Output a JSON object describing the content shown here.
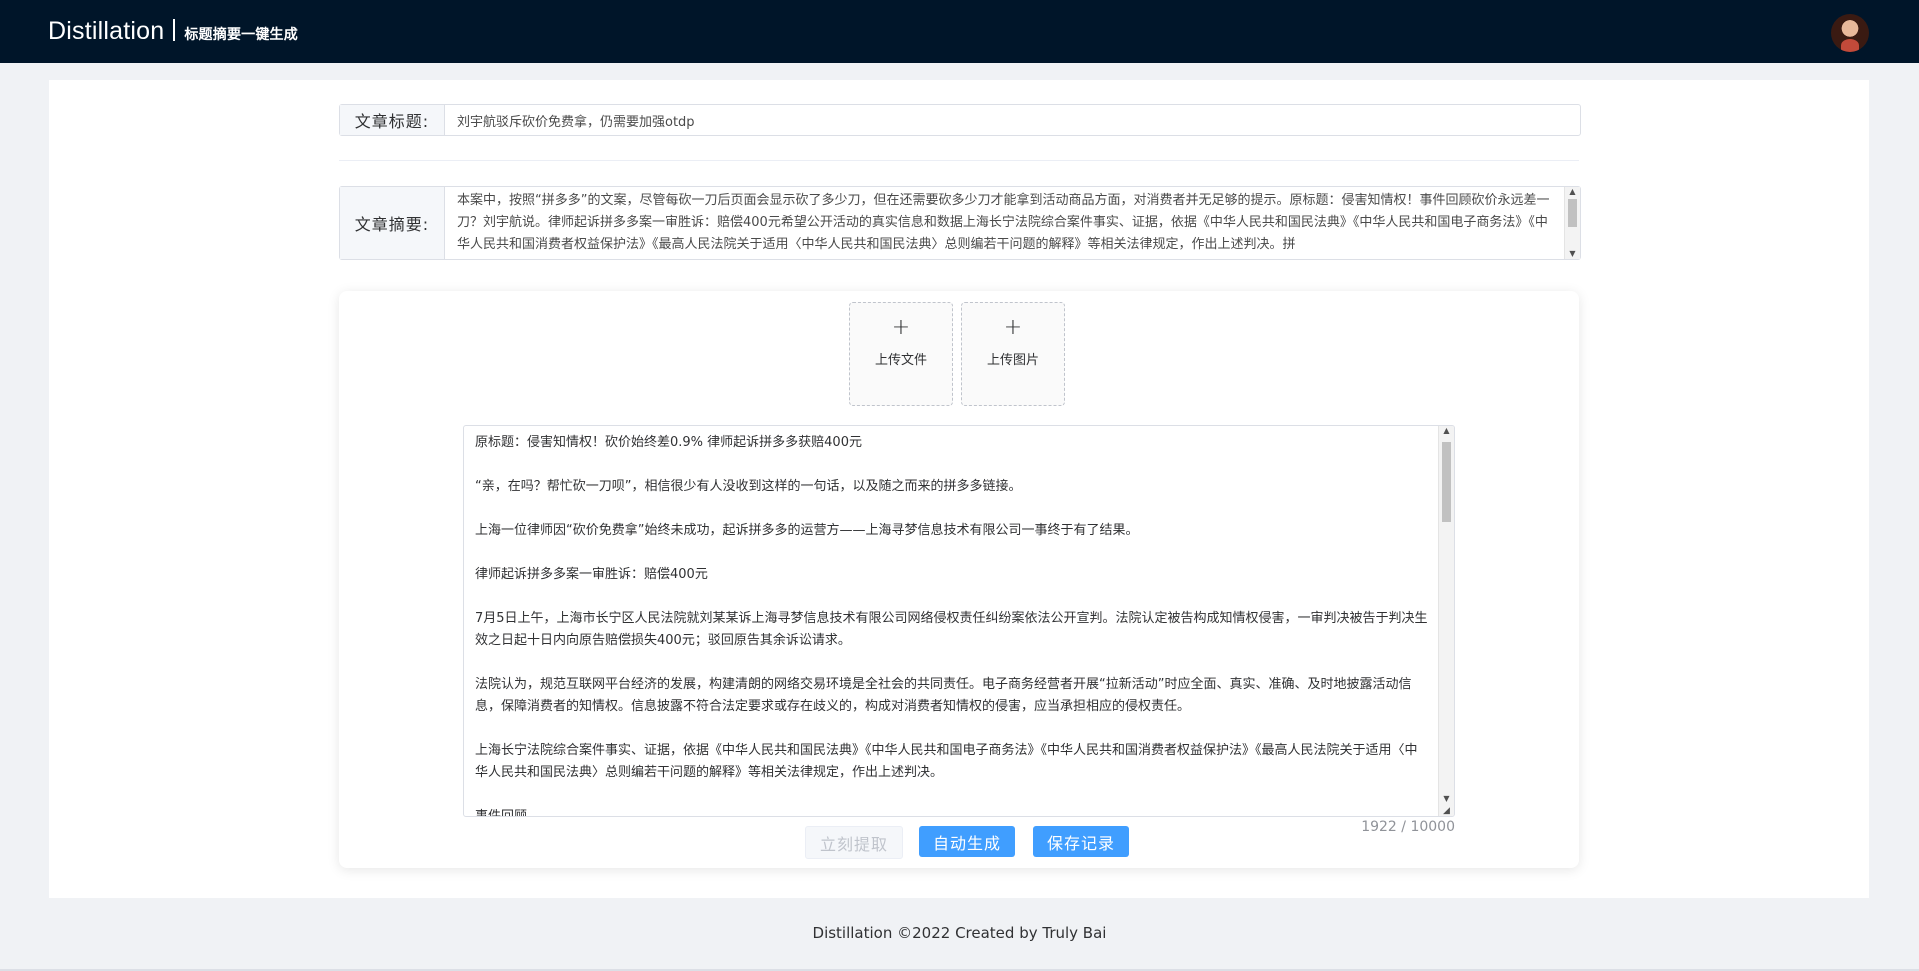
{
  "header": {
    "brand": "Distillation",
    "subtitle": "标题摘要一键生成",
    "avatar_icon": "user-avatar"
  },
  "title_field": {
    "label": "文章标题:",
    "value": "刘宇航驳斥砍价免费拿，仍需要加强otdp"
  },
  "summary_field": {
    "label": "文章摘要:",
    "value": "本案中，按照“拼多多”的文案，尽管每砍一刀后页面会显示砍了多少刀，但在还需要砍多少刀才能拿到活动商品方面，对消费者并无足够的提示。原标题：侵害知情权！事件回顾砍价永远差一刀？刘宇航说。律师起诉拼多多案一审胜诉：赔偿400元希望公开活动的真实信息和数据上海长宁法院综合案件事实、证据，依据《中华人民共和国民法典》《中华人民共和国电子商务法》《中华人民共和国消费者权益保护法》《最高人民法院关于适用〈中华人民共和国民法典〉总则编若干问题的解释》等相关法律规定，作出上述判决。拼"
  },
  "upload": {
    "file_label": "上传文件",
    "image_label": "上传图片",
    "plus": "+"
  },
  "editor": {
    "paragraphs": [
      "原标题：侵害知情权！砍价始终差0.9% 律师起诉拼多多获赔400元",
      "“亲，在吗？帮忙砍一刀呗”，相信很少有人没收到这样的一句话，以及随之而来的拼多多链接。",
      "上海一位律师因“砍价免费拿”始终未成功，起诉拼多多的运营方——上海寻梦信息技术有限公司一事终于有了结果。",
      "律师起诉拼多多案一审胜诉：赔偿400元",
      "7月5日上午，上海市长宁区人民法院就刘某某诉上海寻梦信息技术有限公司网络侵权责任纠纷案依法公开宣判。法院认定被告构成知情权侵害，一审判决被告于判决生效之日起十日内向原告赔偿损失400元；驳回原告其余诉讼请求。",
      "法院认为，规范互联网平台经济的发展，构建清朗的网络交易环境是全社会的共同责任。电子商务经营者开展“拉新活动”时应全面、真实、准确、及时地披露活动信息，保障消费者的知情权。信息披露不符合法定要求或存在歧义的，构成对消费者知情权的侵害，应当承担相应的侵权责任。",
      "上海长宁法院综合案件事实、证据，依据《中华人民共和国民法典》《中华人民共和国电子商务法》《中华人民共和国消费者权益保护法》《最高人民法院关于适用〈中华人民共和国民法典〉总则编若干问题的解释》等相关法律规定，作出上述判决。",
      "事件回顾"
    ],
    "counter": "1922 / 10000"
  },
  "actions": {
    "extract": "立刻提取",
    "generate": "自动生成",
    "save": "保存记录"
  },
  "footer": {
    "text": "Distillation ©2022 Created by Truly Bai"
  }
}
